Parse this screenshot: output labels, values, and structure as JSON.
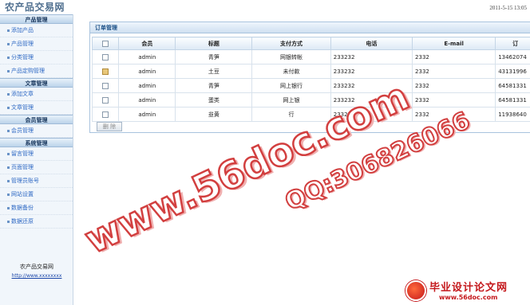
{
  "app_title": "农产品交易网",
  "datetime": "2011-5-15 13:05",
  "sidebar": {
    "sections": [
      {
        "title": "产品管理",
        "items": [
          "添加产品",
          "产品管理",
          "分类管理",
          "产品定购管理"
        ]
      },
      {
        "title": "文章管理",
        "items": [
          "添加文章",
          "文章管理"
        ]
      },
      {
        "title": "会员管理",
        "items": [
          "会员管理"
        ]
      },
      {
        "title": "系统管理",
        "items": [
          "留言管理",
          "页面管理",
          "管理员账号",
          "网站设置",
          "数据备份",
          "数据还原"
        ]
      }
    ],
    "footer_name": "农产品交易网",
    "footer_url": "http://www.xxxxxxxx"
  },
  "main": {
    "panel_title": "订单管理",
    "columns": [
      "会员",
      "标题",
      "支付方式",
      "电话",
      "E-mail",
      "订"
    ],
    "rows": [
      {
        "member": "admin",
        "title": "青笋",
        "payment": "网银转帐",
        "phone": "233232",
        "email": "2332",
        "order": "13462074",
        "highlight": false
      },
      {
        "member": "admin",
        "title": "土豆",
        "payment": "未付款",
        "phone": "233232",
        "email": "2332",
        "order": "43131996",
        "highlight": true
      },
      {
        "member": "admin",
        "title": "青笋",
        "payment": "网上银行",
        "phone": "233232",
        "email": "2332",
        "order": "64581331",
        "highlight": false
      },
      {
        "member": "admin",
        "title": "蛋类",
        "payment": "网上银",
        "phone": "233232",
        "email": "2332",
        "order": "64581331",
        "highlight": false
      },
      {
        "member": "admin",
        "title": "韭黄",
        "payment": "行",
        "phone": "233232",
        "email": "2332",
        "order": "11938640",
        "highlight": false
      }
    ],
    "delete_label": "删 除"
  },
  "watermark": {
    "site": "www.56doc.com",
    "qq": "QQ:306826066",
    "brand_cn": "毕业设计论文网",
    "brand_url": "www.56doc.com"
  }
}
